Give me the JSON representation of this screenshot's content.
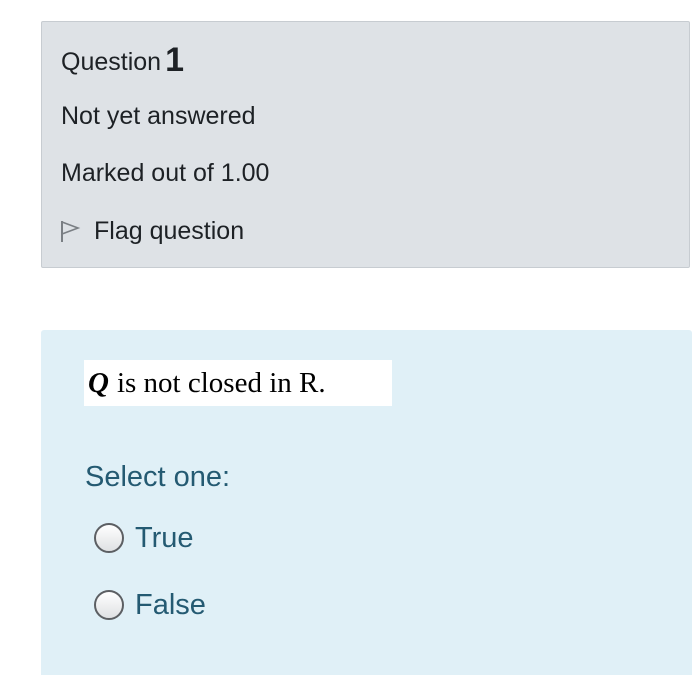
{
  "question_info": {
    "label": "Question",
    "number": "1",
    "state": "Not yet answered",
    "grade": "Marked out of 1.00",
    "flag_label": "Flag question",
    "flag_icon": "flag-outline-icon"
  },
  "question_content": {
    "text_variable": "Q",
    "text_rest": "is not closed in R.",
    "prompt": "Select one:",
    "options": [
      {
        "label": "True",
        "selected": false
      },
      {
        "label": "False",
        "selected": false
      }
    ]
  },
  "colors": {
    "info_background": "#dee2e6",
    "content_background": "#e0f0f7",
    "answer_text": "#245a72"
  }
}
